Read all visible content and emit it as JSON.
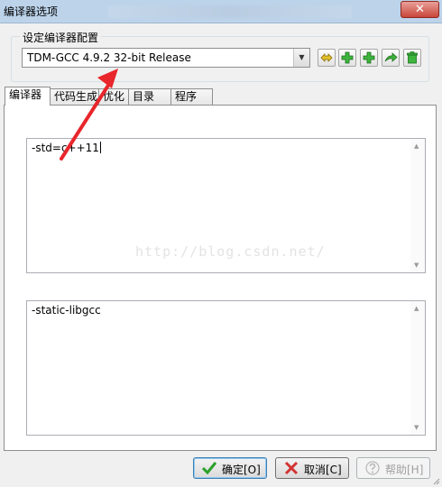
{
  "window": {
    "title": "编译器选项"
  },
  "config_group": {
    "label": "设定编译器配置",
    "selected_compiler": "TDM-GCC 4.9.2 32-bit Release",
    "toolbar_icons": [
      "rename-icon",
      "add-icon",
      "add-icon",
      "arrow-icon",
      "delete-icon"
    ]
  },
  "tabs": [
    {
      "label": "编译器",
      "active": true
    },
    {
      "label": "代码生成",
      "active": false
    },
    {
      "label": "优化",
      "active": false
    },
    {
      "label": "目录",
      "active": false
    },
    {
      "label": "程序",
      "active": false
    }
  ],
  "compiler_commands": {
    "value": "-std=c++11"
  },
  "linker_commands": {
    "value": "-static-libgcc"
  },
  "watermark": "http://blog.csdn.net/",
  "buttons": {
    "ok": "确定[O]",
    "cancel": "取消[C]",
    "help": "帮助[H]"
  },
  "colors": {
    "annotation_arrow": "#e8262b",
    "titlebar": "#bcd3ea",
    "ok_icon": "#2aa12a",
    "cancel_icon": "#d33333"
  }
}
